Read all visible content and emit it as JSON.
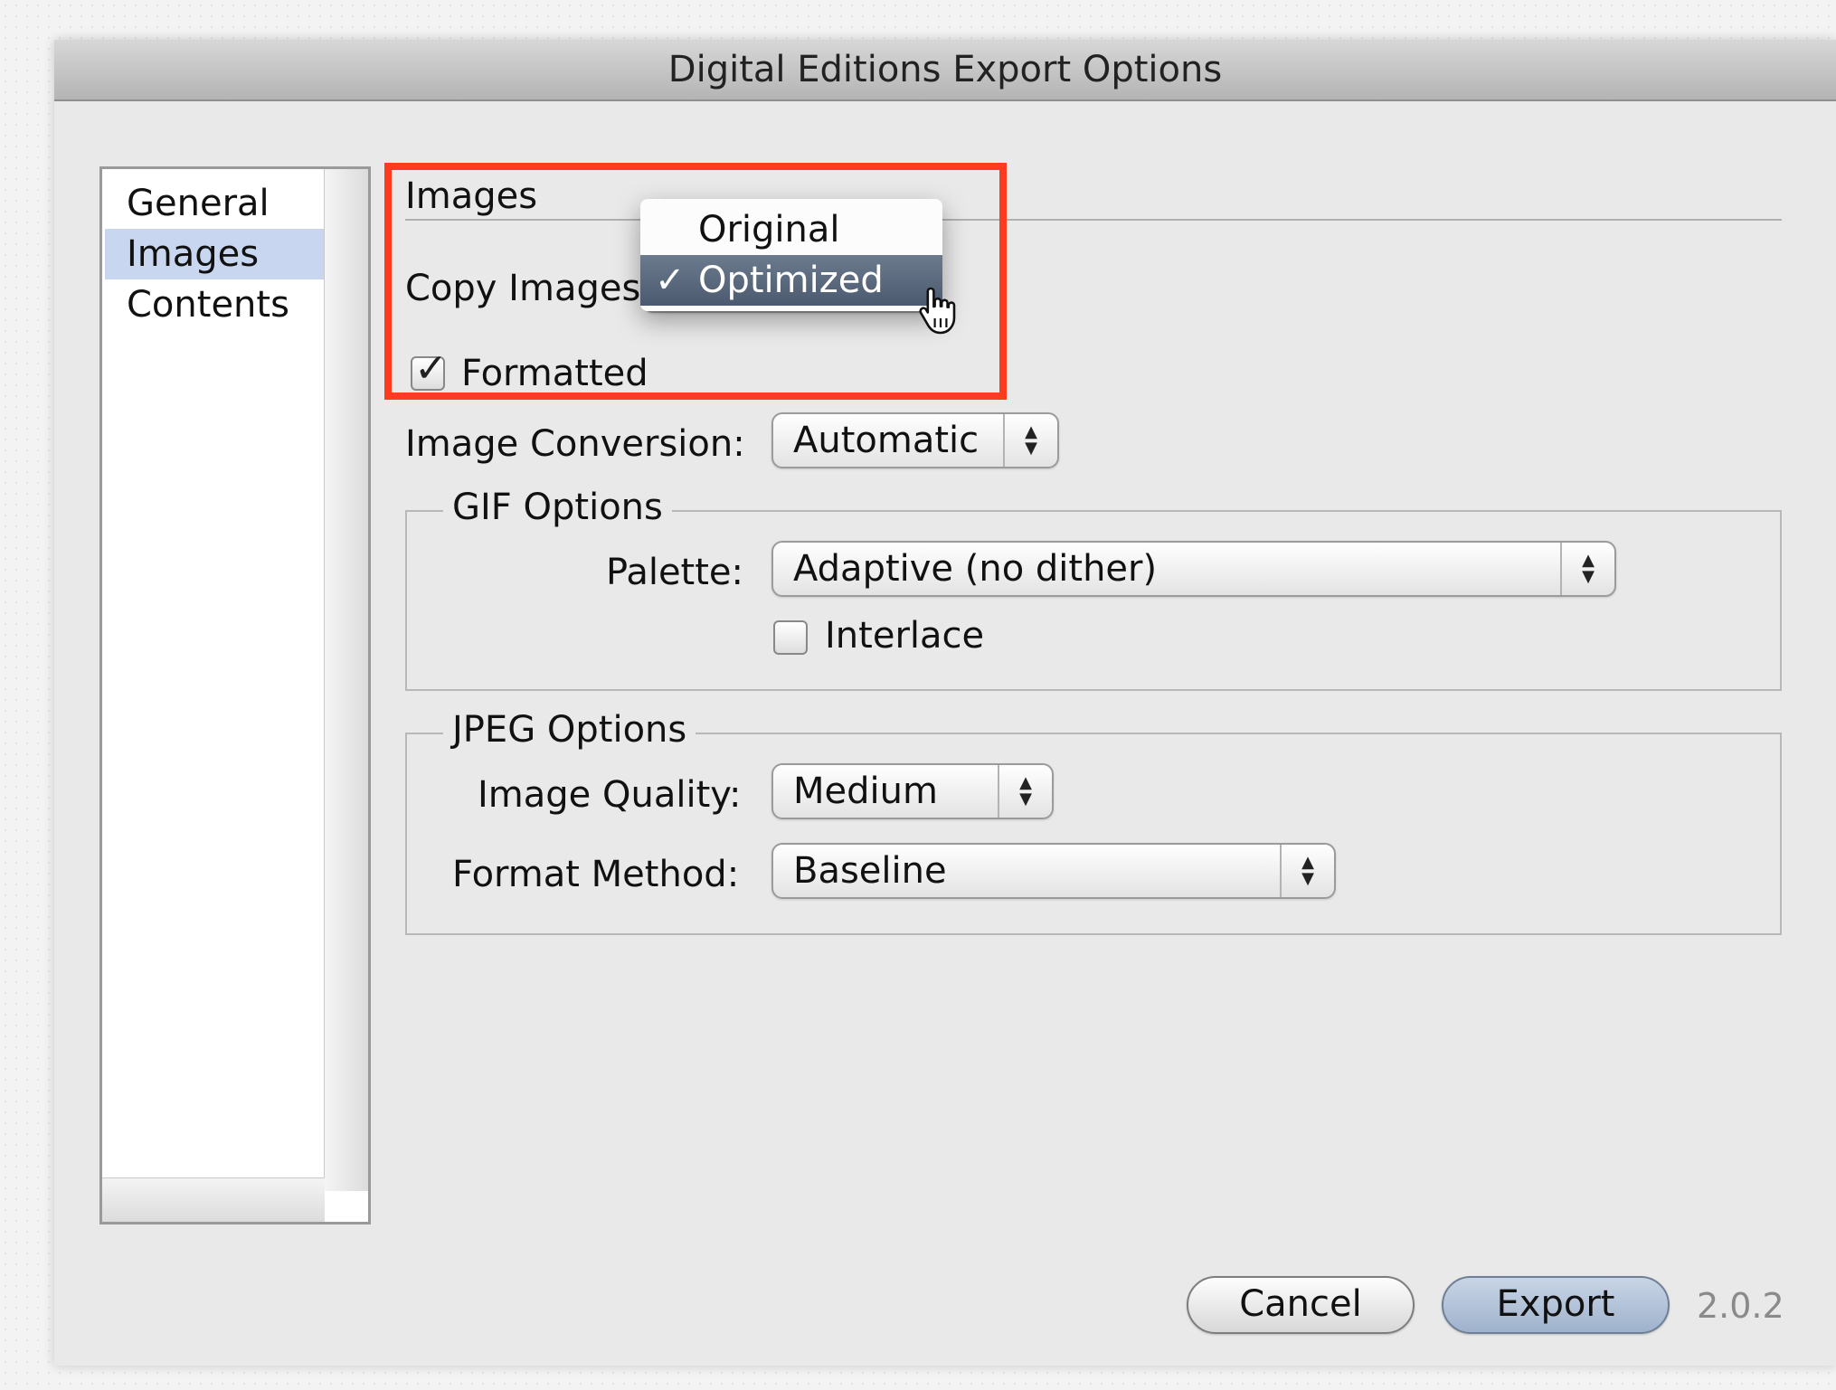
{
  "window": {
    "title": "Digital Editions Export Options"
  },
  "sidebar": {
    "items": [
      {
        "label": "General",
        "selected": false
      },
      {
        "label": "Images",
        "selected": true
      },
      {
        "label": "Contents",
        "selected": false
      }
    ]
  },
  "section": {
    "title": "Images"
  },
  "copy_images": {
    "label": "Copy Images:",
    "menu": {
      "options": [
        {
          "label": "Original",
          "selected": false
        },
        {
          "label": "Optimized",
          "selected": true
        }
      ],
      "check_glyph": "✓"
    }
  },
  "formatted": {
    "label": "Formatted",
    "checked": true
  },
  "image_conversion": {
    "label": "Image Conversion:",
    "value": "Automatic"
  },
  "gif_options": {
    "title": "GIF Options",
    "palette_label": "Palette:",
    "palette_value": "Adaptive (no dither)",
    "interlace_label": "Interlace",
    "interlace_checked": false
  },
  "jpeg_options": {
    "title": "JPEG Options",
    "quality_label": "Image Quality:",
    "quality_value": "Medium",
    "format_label": "Format Method:",
    "format_value": "Baseline"
  },
  "buttons": {
    "cancel": "Cancel",
    "export": "Export"
  },
  "version": "2.0.2",
  "colors": {
    "highlight": "#ff3b1f",
    "selection": "#c8d7ef",
    "menu_selected": "#5a687d"
  },
  "icons": {
    "cursor": "hand-pointer-icon",
    "popup_arrows": "up-down-arrows-icon"
  }
}
